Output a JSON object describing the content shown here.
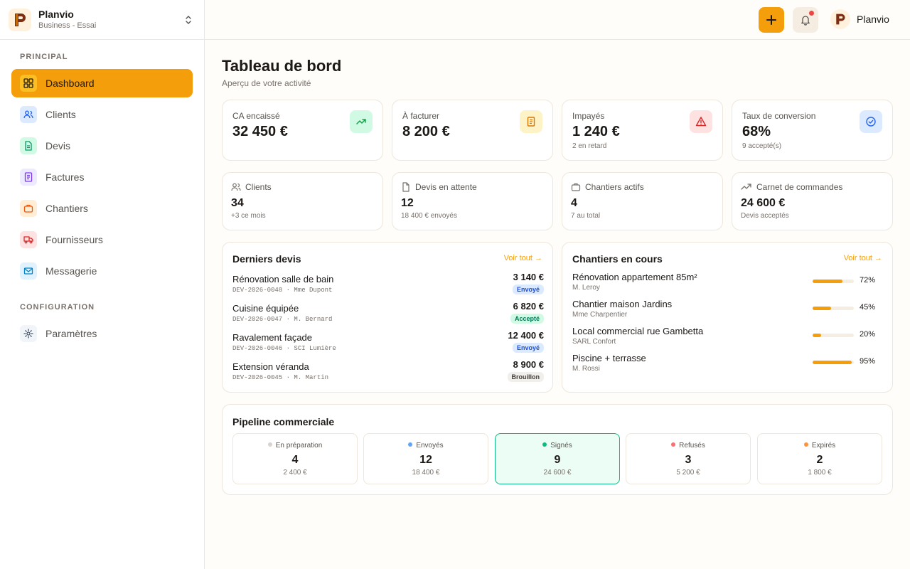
{
  "brand": {
    "name": "Planvio",
    "plan": "Business - Essai"
  },
  "sidebar": {
    "section_principal": "PRINCIPAL",
    "section_config": "CONFIGURATION",
    "items": [
      {
        "label": "Dashboard",
        "icon": "dashboard-icon",
        "active": true
      },
      {
        "label": "Clients",
        "icon": "users-icon"
      },
      {
        "label": "Devis",
        "icon": "document-icon"
      },
      {
        "label": "Factures",
        "icon": "invoice-icon"
      },
      {
        "label": "Chantiers",
        "icon": "briefcase-icon"
      },
      {
        "label": "Fournisseurs",
        "icon": "truck-icon"
      },
      {
        "label": "Messagerie",
        "icon": "mail-icon"
      }
    ],
    "settings": {
      "label": "Paramètres",
      "icon": "gear-icon"
    }
  },
  "header": {
    "user_name": "Planvio"
  },
  "page": {
    "title": "Tableau de bord",
    "subtitle": "Aperçu de votre activité"
  },
  "kpis": [
    {
      "label": "CA encaissé",
      "value": "32 450 €",
      "sub": "",
      "icon": "trending-up-icon",
      "color": "#16a34a"
    },
    {
      "label": "À facturer",
      "value": "8 200 €",
      "sub": "",
      "icon": "invoice-icon",
      "color": "#d97706"
    },
    {
      "label": "Impayés",
      "value": "1 240 €",
      "sub": "2 en retard",
      "icon": "alert-icon",
      "color": "#dc2626"
    },
    {
      "label": "Taux de conversion",
      "value": "68%",
      "sub": "9 accepté(s)",
      "icon": "check-circle-icon",
      "color": "#2563eb"
    }
  ],
  "stats": [
    {
      "label": "Clients",
      "value": "34",
      "sub": "+3 ce mois",
      "icon": "users-icon"
    },
    {
      "label": "Devis en attente",
      "value": "12",
      "sub": "18 400 € envoyés",
      "icon": "file-icon"
    },
    {
      "label": "Chantiers actifs",
      "value": "4",
      "sub": "7 au total",
      "icon": "briefcase-icon"
    },
    {
      "label": "Carnet de commandes",
      "value": "24 600 €",
      "sub": "Devis acceptés",
      "icon": "trending-up-icon"
    }
  ],
  "recent_quotes": {
    "title": "Derniers devis",
    "link": "Voir tout →",
    "rows": [
      {
        "name": "Rénovation salle de bain",
        "ref": "DEV-2026-0048 · Mme Dupont",
        "amount": "3 140 €",
        "status": "Envoyé",
        "status_kind": "blue"
      },
      {
        "name": "Cuisine équipée",
        "ref": "DEV-2026-0047 · M. Bernard",
        "amount": "6 820 €",
        "status": "Accepté",
        "status_kind": "green"
      },
      {
        "name": "Ravalement façade",
        "ref": "DEV-2026-0046 · SCI Lumière",
        "amount": "12 400 €",
        "status": "Envoyé",
        "status_kind": "blue"
      },
      {
        "name": "Extension véranda",
        "ref": "DEV-2026-0045 · M. Martin",
        "amount": "8 900 €",
        "status": "Brouillon",
        "status_kind": "gray"
      }
    ]
  },
  "sites": {
    "title": "Chantiers en cours",
    "link": "Voir tout →",
    "rows": [
      {
        "name": "Rénovation appartement 85m²",
        "client": "M. Leroy",
        "progress": 72,
        "progress_label": "72%"
      },
      {
        "name": "Chantier maison Jardins",
        "client": "Mme Charpentier",
        "progress": 45,
        "progress_label": "45%"
      },
      {
        "name": "Local commercial rue Gambetta",
        "client": "SARL Confort",
        "progress": 20,
        "progress_label": "20%"
      },
      {
        "name": "Piscine + terrasse",
        "client": "M. Rossi",
        "progress": 95,
        "progress_label": "95%"
      }
    ]
  },
  "pipeline": {
    "title": "Pipeline commerciale",
    "stages": [
      {
        "label": "En préparation",
        "count": "4",
        "amount": "2 400 €",
        "dot": "#d6d3d1",
        "active": false
      },
      {
        "label": "Envoyés",
        "count": "12",
        "amount": "18 400 €",
        "dot": "#60a5fa",
        "active": false
      },
      {
        "label": "Signés",
        "count": "9",
        "amount": "24 600 €",
        "dot": "#10b981",
        "active": true
      },
      {
        "label": "Refusés",
        "count": "3",
        "amount": "5 200 €",
        "dot": "#f87171",
        "active": false
      },
      {
        "label": "Expirés",
        "count": "2",
        "amount": "1 800 €",
        "dot": "#fb923c",
        "active": false
      }
    ]
  },
  "colors": {
    "accent": "#f59e0b",
    "border": "#eee6da",
    "success": "#10b981"
  }
}
